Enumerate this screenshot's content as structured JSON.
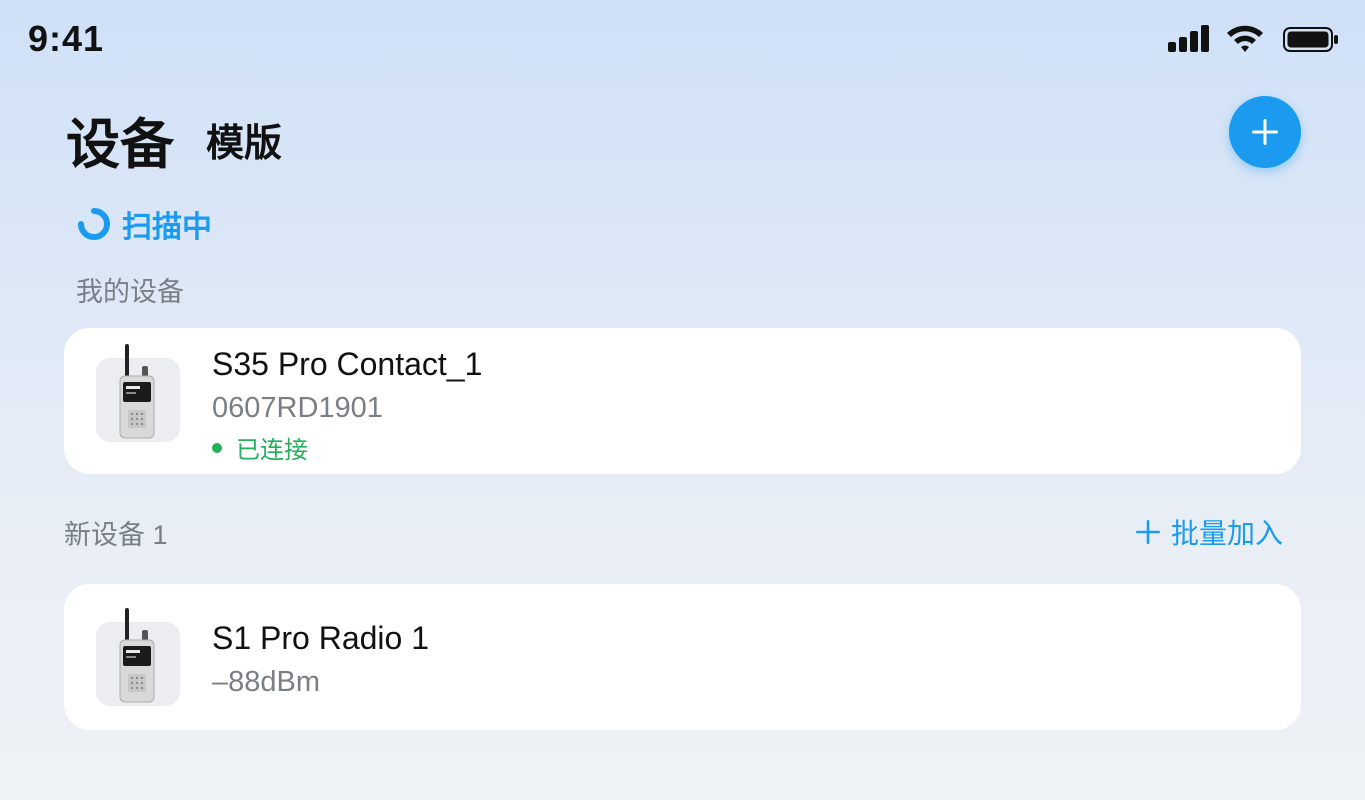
{
  "status_bar": {
    "time": "9:41",
    "signal_icon": "cellular-signal-icon",
    "wifi_icon": "wifi-icon",
    "battery_icon": "battery-icon"
  },
  "header": {
    "title": "设备",
    "tab_template": "模版",
    "add_icon": "plus-icon"
  },
  "scanning": {
    "icon": "loading-spinner-icon",
    "label": "扫描中"
  },
  "my_devices": {
    "label": "我的设备",
    "items": [
      {
        "name": "S35 Pro Contact_1",
        "serial": "0607RD1901",
        "status": "已连接",
        "thumb_icon": "walkie-talkie-icon",
        "status_color": "#22b15a"
      }
    ]
  },
  "new_devices": {
    "label": "新设备 1",
    "batch_add_label": "批量加入",
    "batch_add_icon": "plus-icon",
    "items": [
      {
        "name": "S1 Pro Radio 1",
        "signal": "–88dBm",
        "thumb_icon": "walkie-talkie-icon"
      }
    ]
  },
  "colors": {
    "accent": "#1a9bf0",
    "connected": "#22b15a",
    "secondary_text": "#7a7f87"
  }
}
